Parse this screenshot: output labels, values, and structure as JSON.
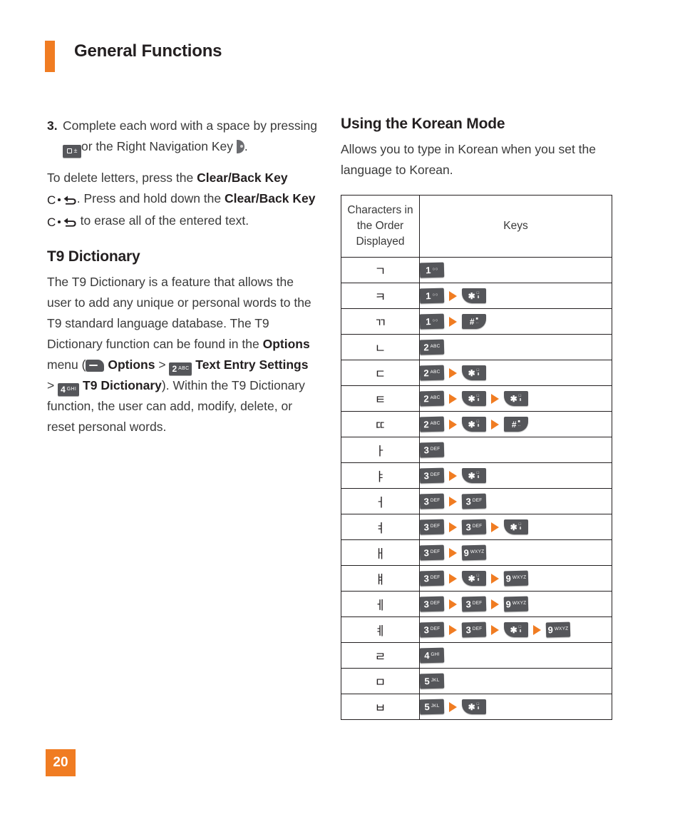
{
  "header": {
    "title": "General Functions",
    "accent_color": "#F07C22"
  },
  "page_number": "20",
  "left_column": {
    "step": {
      "number": "3.",
      "text_before_key": "Complete each word with a space by pressing",
      "text_after_key": "or the Right Navigation Key",
      "text_end": ".",
      "key_icon": "zero-space-key",
      "nav_icon": "right-navigation-key"
    },
    "delete_paragraph": {
      "p1": "To delete letters, press the",
      "b1": "Clear/Back Key",
      "p2": ". Press and hold down the",
      "b2": "Clear/Back",
      "b3": "Key",
      "p3": "to erase all of the entered text."
    },
    "t9": {
      "heading": "T9 Dictionary",
      "p1": "The T9 Dictionary is a feature that allows the user to add any unique or personal words to the T9 standard language database. The T9 Dictionary function can be found in the",
      "b_options": "Options",
      "p2": "menu (",
      "b_options2": "Options",
      "gt1": ">",
      "b_text_entry": "Text Entry Settings",
      "gt2": ">",
      "b_t9dict": "T9 Dictionary",
      "p3": "). Within the T9 Dictionary function, the user can add, modify, delete, or reset personal words.",
      "key_2abc": {
        "digit": "2",
        "sub": "ABC"
      },
      "key_4ghi": {
        "digit": "4",
        "sub": "GHI"
      }
    }
  },
  "right_column": {
    "heading": "Using the Korean Mode",
    "intro": "Allows you to type in Korean when you set the language to Korean.",
    "table": {
      "headers": {
        "characters": "Characters in the Order Displayed",
        "keys": "Keys"
      },
      "rows": [
        {
          "char": "ㄱ",
          "keys": [
            {
              "type": "num",
              "digit": "1",
              "sub": "○○"
            }
          ]
        },
        {
          "char": "ㅋ",
          "keys": [
            {
              "type": "num",
              "digit": "1",
              "sub": "○○"
            },
            {
              "type": "star"
            }
          ]
        },
        {
          "char": "ㄲ",
          "keys": [
            {
              "type": "num",
              "digit": "1",
              "sub": "○○"
            },
            {
              "type": "hash"
            }
          ]
        },
        {
          "char": "ㄴ",
          "keys": [
            {
              "type": "num",
              "digit": "2",
              "sub": "ABC"
            }
          ]
        },
        {
          "char": "ㄷ",
          "keys": [
            {
              "type": "num",
              "digit": "2",
              "sub": "ABC"
            },
            {
              "type": "star"
            }
          ]
        },
        {
          "char": "ㅌ",
          "keys": [
            {
              "type": "num",
              "digit": "2",
              "sub": "ABC"
            },
            {
              "type": "star"
            },
            {
              "type": "star"
            }
          ]
        },
        {
          "char": "ㄸ",
          "keys": [
            {
              "type": "num",
              "digit": "2",
              "sub": "ABC"
            },
            {
              "type": "star"
            },
            {
              "type": "hash"
            }
          ]
        },
        {
          "char": "ㅏ",
          "keys": [
            {
              "type": "num",
              "digit": "3",
              "sub": "DEF"
            }
          ]
        },
        {
          "char": "ㅑ",
          "keys": [
            {
              "type": "num",
              "digit": "3",
              "sub": "DEF"
            },
            {
              "type": "star"
            }
          ]
        },
        {
          "char": "ㅓ",
          "keys": [
            {
              "type": "num",
              "digit": "3",
              "sub": "DEF"
            },
            {
              "type": "num",
              "digit": "3",
              "sub": "DEF"
            }
          ]
        },
        {
          "char": "ㅕ",
          "keys": [
            {
              "type": "num",
              "digit": "3",
              "sub": "DEF"
            },
            {
              "type": "num",
              "digit": "3",
              "sub": "DEF"
            },
            {
              "type": "star"
            }
          ]
        },
        {
          "char": "ㅐ",
          "keys": [
            {
              "type": "num",
              "digit": "3",
              "sub": "DEF"
            },
            {
              "type": "num",
              "digit": "9",
              "sub": "WXYZ"
            }
          ]
        },
        {
          "char": "ㅒ",
          "keys": [
            {
              "type": "num",
              "digit": "3",
              "sub": "DEF"
            },
            {
              "type": "star"
            },
            {
              "type": "num",
              "digit": "9",
              "sub": "WXYZ"
            }
          ]
        },
        {
          "char": "ㅔ",
          "keys": [
            {
              "type": "num",
              "digit": "3",
              "sub": "DEF"
            },
            {
              "type": "num",
              "digit": "3",
              "sub": "DEF"
            },
            {
              "type": "num",
              "digit": "9",
              "sub": "WXYZ"
            }
          ]
        },
        {
          "char": "ㅖ",
          "keys": [
            {
              "type": "num",
              "digit": "3",
              "sub": "DEF"
            },
            {
              "type": "num",
              "digit": "3",
              "sub": "DEF"
            },
            {
              "type": "star"
            },
            {
              "type": "num",
              "digit": "9",
              "sub": "WXYZ"
            }
          ]
        },
        {
          "char": "ㄹ",
          "keys": [
            {
              "type": "num",
              "digit": "4",
              "sub": "GHI"
            }
          ]
        },
        {
          "char": "ㅁ",
          "keys": [
            {
              "type": "num",
              "digit": "5",
              "sub": "JKL"
            }
          ]
        },
        {
          "char": "ㅂ",
          "keys": [
            {
              "type": "num",
              "digit": "5",
              "sub": "JKL"
            },
            {
              "type": "star"
            }
          ]
        }
      ]
    }
  }
}
